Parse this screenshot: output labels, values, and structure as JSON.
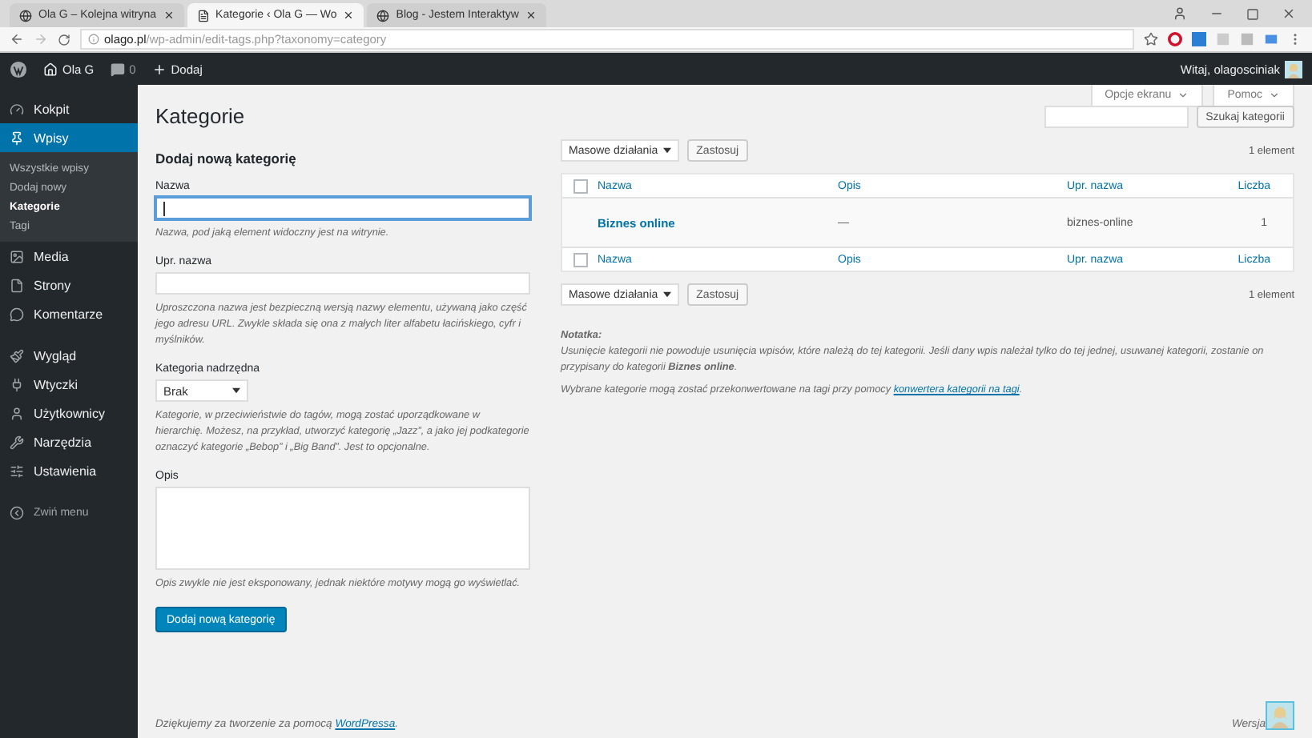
{
  "browser": {
    "tabs": [
      {
        "title": "Ola G – Kolejna witryna",
        "selected": false
      },
      {
        "title": "Kategorie ‹ Ola G — Wo",
        "selected": true
      },
      {
        "title": "Blog - Jestem Interaktyw",
        "selected": false
      }
    ],
    "url": {
      "host": "olago.pl",
      "path": "/wp-admin/edit-tags.php?taxonomy=category"
    }
  },
  "admin_bar": {
    "site": "Ola G",
    "comments": "0",
    "new": "Dodaj",
    "greeting": "Witaj, olagosciniak"
  },
  "sidebar": {
    "groups": [
      [
        {
          "label": "Kokpit",
          "selected": false
        },
        {
          "label": "Wpisy",
          "selected": true,
          "children": [
            {
              "label": "Wszystkie wpisy",
              "selected": false
            },
            {
              "label": "Dodaj nowy",
              "selected": false
            },
            {
              "label": "Kategorie",
              "selected": true
            },
            {
              "label": "Tagi",
              "selected": false
            }
          ]
        },
        {
          "label": "Media",
          "selected": false
        },
        {
          "label": "Strony",
          "selected": false
        },
        {
          "label": "Komentarze",
          "selected": false
        }
      ],
      [
        {
          "label": "Wygląd",
          "selected": false
        },
        {
          "label": "Wtyczki",
          "selected": false
        },
        {
          "label": "Użytkownicy",
          "selected": false
        },
        {
          "label": "Narzędzia",
          "selected": false
        },
        {
          "label": "Ustawienia",
          "selected": false
        }
      ]
    ],
    "collapse": "Zwiń menu"
  },
  "top_buttons": [
    "Opcje ekranu",
    "Pomoc"
  ],
  "page_title": "Kategorie",
  "form": {
    "heading": "Dodaj nową kategorię",
    "fields": [
      {
        "kind": "text",
        "label": "Nazwa",
        "focused": true,
        "hint": "Nazwa, pod jaką element widoczny jest na witrynie."
      },
      {
        "kind": "text",
        "label": "Upr. nazwa",
        "focused": false,
        "hint": "Uproszczona nazwa jest bezpieczną wersją nazwy elementu, używaną jako część jego adresu URL. Zwykle składa się ona z małych liter alfabetu łacińskiego, cyfr i myślników."
      },
      {
        "kind": "select",
        "label": "Kategoria nadrzędna",
        "value": "Brak",
        "hint": "Kategorie, w przeciwieństwie do tagów, mogą zostać uporządkowane w hierarchię. Możesz, na przykład, utworzyć kategorię „Jazz”, a jako jej podkategorie oznaczyć kategorie „Bebop” i „Big Band”. Jest to opcjonalne."
      },
      {
        "kind": "textarea",
        "label": "Opis",
        "hint": "Opis zwykle nie jest eksponowany, jednak niektóre motywy mogą go wyświetlać."
      }
    ],
    "submit": "Dodaj nową kategorię"
  },
  "search": {
    "button": "Szukaj kategorii"
  },
  "bulk_bars": [
    {
      "select": "Masowe działania",
      "apply": "Zastosuj",
      "count": "1 element"
    },
    {
      "select": "Masowe działania",
      "apply": "Zastosuj",
      "count": "1 element"
    }
  ],
  "table": {
    "header": {
      "checked": false,
      "columns": [
        "Nazwa",
        "Opis",
        "Upr. nazwa",
        "Liczba"
      ]
    },
    "rows": [
      {
        "name": "Biznes online",
        "description": "—",
        "slug": "biznes-online",
        "count": "1"
      }
    ],
    "footer": {
      "checked": false,
      "columns": [
        "Nazwa",
        "Opis",
        "Upr. nazwa",
        "Liczba"
      ]
    }
  },
  "note": {
    "title": "Notatka:",
    "text": "Usunięcie kategorii nie powoduje usunięcia wpisów, które należą do tej kategorii. Jeśli dany wpis należał tylko do tej jednej, usuwanej kategorii, zostanie on przypisany do kategorii **Biznes online**.",
    "convert_text": "Wybrane kategorie mogą zostać przekonwertowane na tagi przy pomocy",
    "convert_link": "konwertera kategorii na tagi",
    "convert_end": "."
  },
  "footer": {
    "before": "Dziękujemy za tworzenie za pomocą",
    "link": "WordPressa",
    "after": ".",
    "version": "Wersja"
  }
}
